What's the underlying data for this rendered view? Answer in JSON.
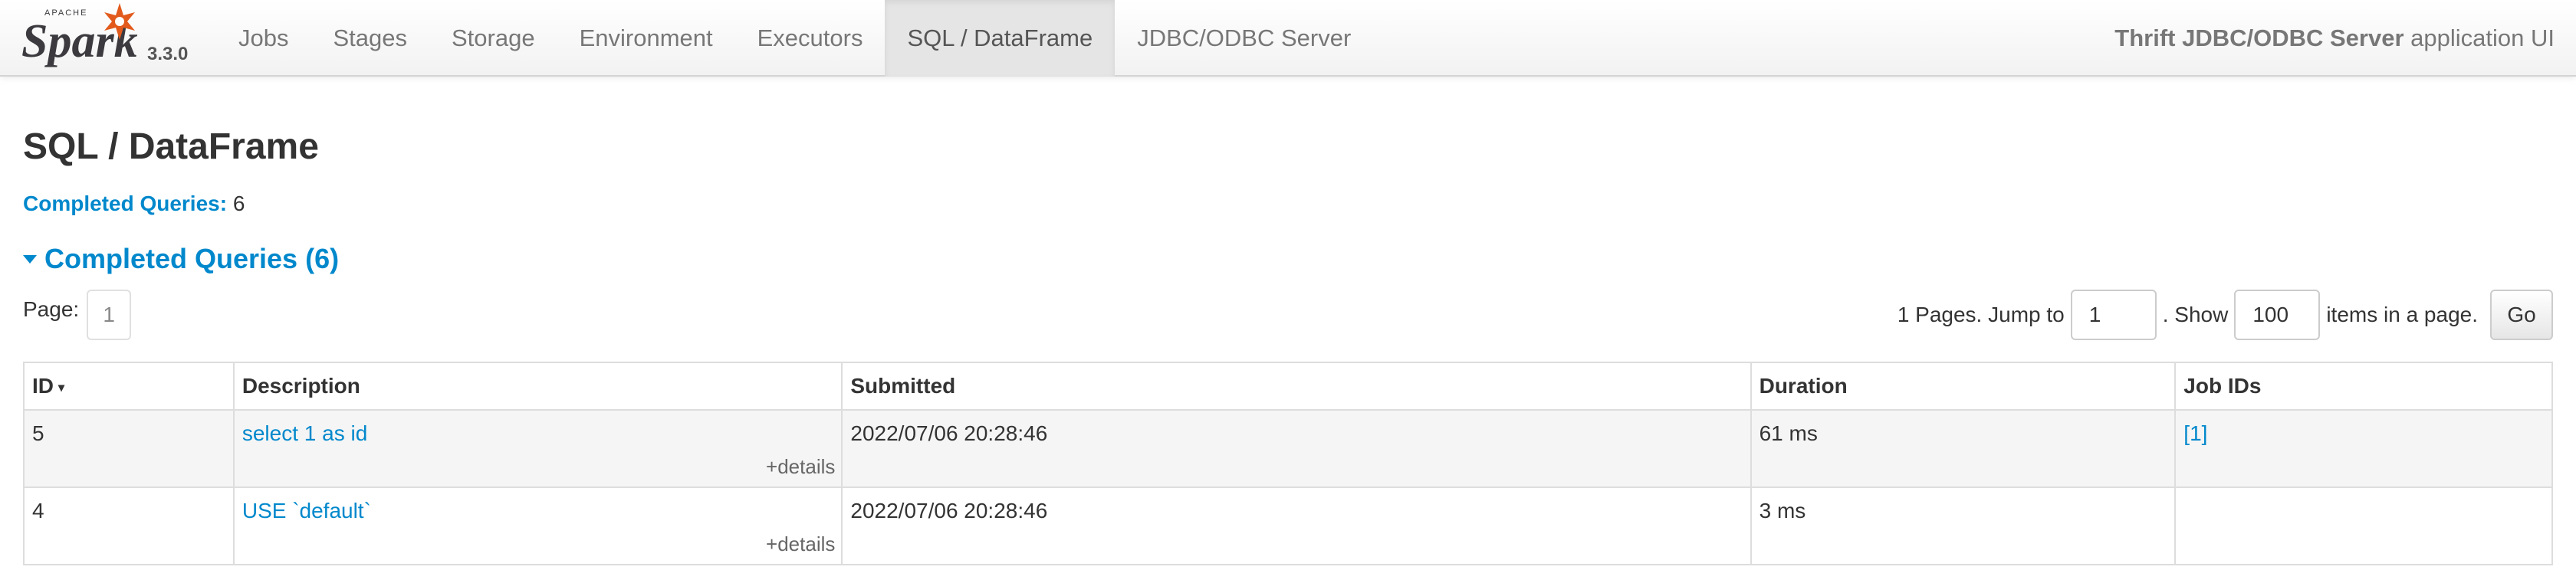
{
  "navbar": {
    "brand_small": "APACHE",
    "brand_name": "Spark",
    "version": "3.3.0",
    "tabs": [
      {
        "label": "Jobs",
        "active": false
      },
      {
        "label": "Stages",
        "active": false
      },
      {
        "label": "Storage",
        "active": false
      },
      {
        "label": "Environment",
        "active": false
      },
      {
        "label": "Executors",
        "active": false
      },
      {
        "label": "SQL / DataFrame",
        "active": true
      },
      {
        "label": "JDBC/ODBC Server",
        "active": false
      }
    ],
    "app_title_bold": "Thrift JDBC/ODBC Server",
    "app_title_rest": " application UI"
  },
  "page": {
    "title": "SQL / DataFrame",
    "summary_label": "Completed Queries:",
    "summary_value": "6",
    "section_title": "Completed Queries (6)"
  },
  "pagination": {
    "page_label": "Page:",
    "current_page": "1",
    "pages_text": "1 Pages. Jump to",
    "jump_value": "1",
    "show_text": ". Show",
    "show_value": "100",
    "items_text": "items in a page.",
    "go_label": "Go"
  },
  "table": {
    "columns": [
      "ID",
      "Description",
      "Submitted",
      "Duration",
      "Job IDs"
    ],
    "sort_indicator": "▾",
    "details_label": "+details",
    "rows": [
      {
        "id": "5",
        "description": "select 1 as id",
        "submitted": "2022/07/06 20:28:46",
        "duration": "61 ms",
        "job_ids": "[1]"
      },
      {
        "id": "4",
        "description": "USE `default`",
        "submitted": "2022/07/06 20:28:46",
        "duration": "3 ms",
        "job_ids": ""
      }
    ]
  },
  "colors": {
    "link": "#0088cc",
    "spark_orange": "#e25a1c",
    "spark_text": "#3c3a3e"
  }
}
